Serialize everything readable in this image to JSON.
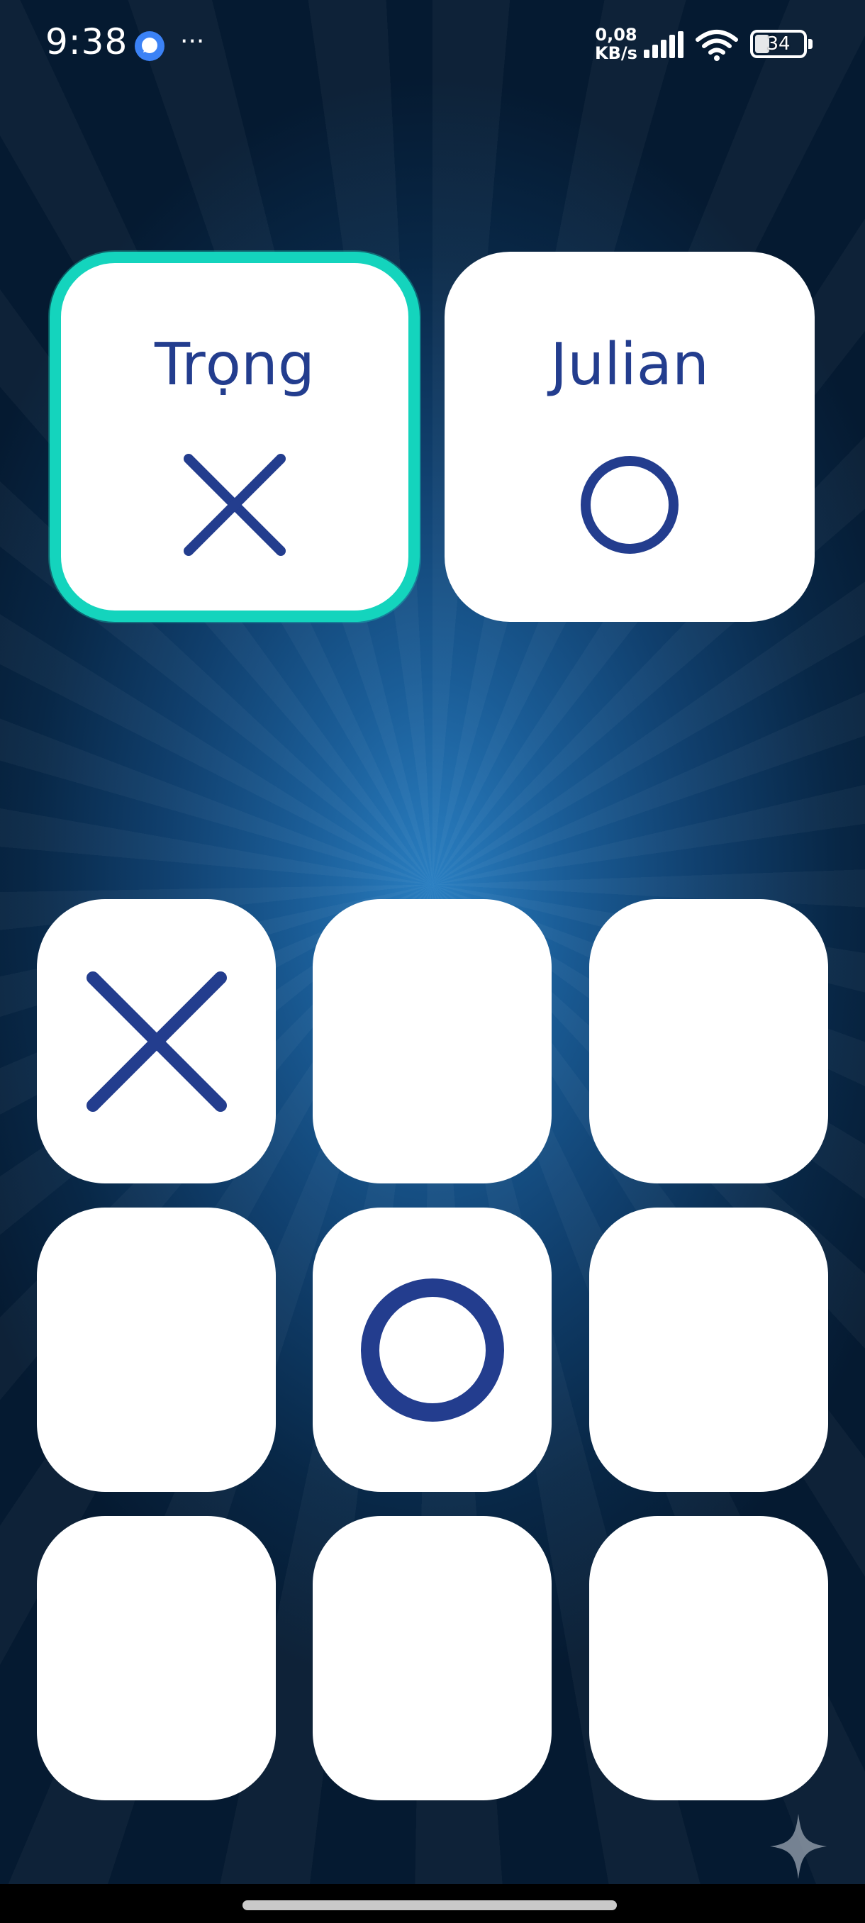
{
  "status_bar": {
    "time": "9:38",
    "net_speed_value": "0,08",
    "net_speed_unit": "KB/s",
    "battery": "34",
    "icons": [
      "messenger-icon",
      "more-dots-icon",
      "signal-icon",
      "wifi-icon",
      "battery-icon"
    ]
  },
  "players": [
    {
      "name": "Trọng",
      "symbol": "X",
      "active": true
    },
    {
      "name": "Julian",
      "symbol": "O",
      "active": false
    }
  ],
  "board": [
    "X",
    "",
    "",
    "",
    "O",
    "",
    "",
    "",
    ""
  ],
  "colors": {
    "mark": "#233d8e",
    "active_border": "#14d4bd",
    "card": "#ffffff",
    "background": "#0a2746"
  }
}
